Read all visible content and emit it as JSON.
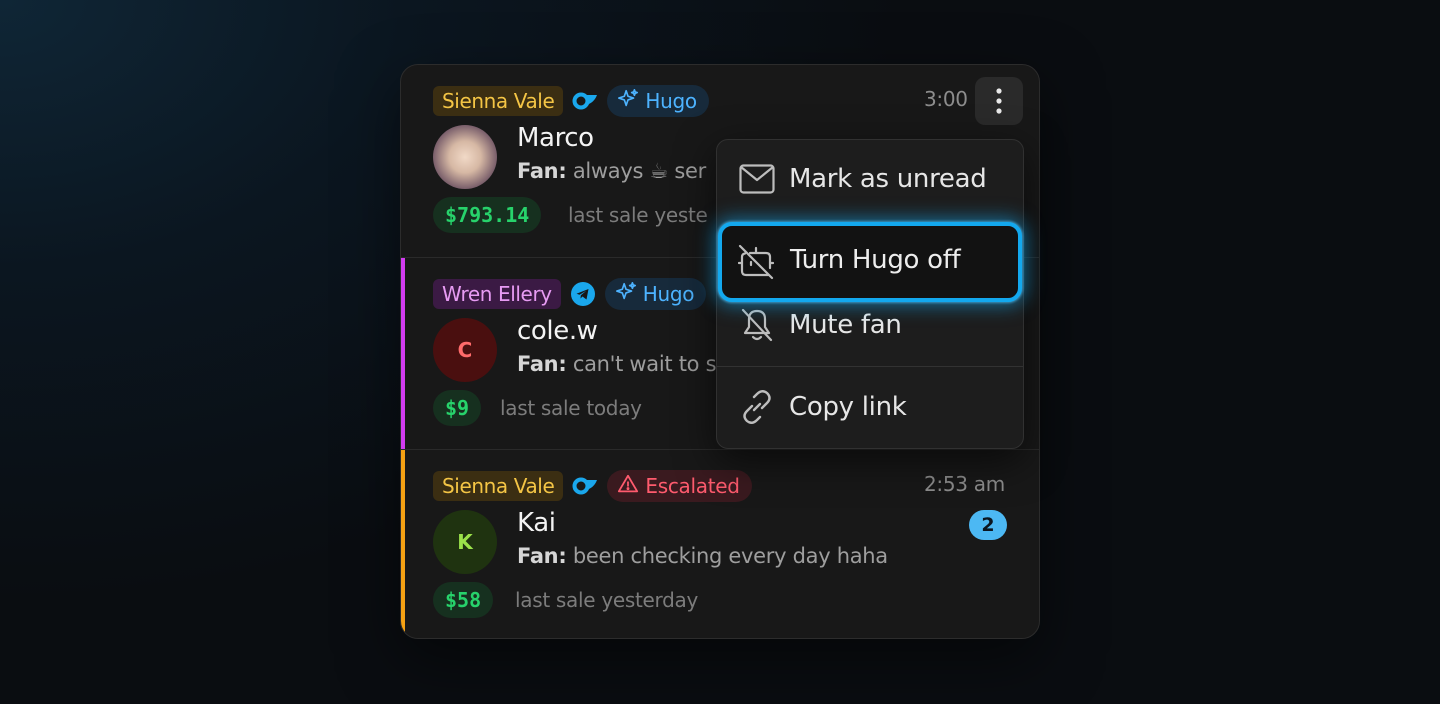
{
  "colors": {
    "accent_gold": "#f4c545",
    "accent_violet": "#d33cf0",
    "accent_orange": "#f5a113",
    "hugo_blue": "#4db3ff",
    "escalated_red": "#ff5b6e",
    "money_green": "#27d26b",
    "focus_ring": "#13a8ee"
  },
  "conversations": [
    {
      "creator": "Sienna Vale",
      "platform_icon": "onlyfans-icon",
      "status_pill": "Hugo",
      "time": "3:00",
      "name": "Marco",
      "preview_prefix": "Fan:",
      "preview_text": "always ☕ ser",
      "amount": "$793.14",
      "last_sale": "last sale yeste"
    },
    {
      "creator": "Wren Ellery",
      "platform_icon": "telegram-icon",
      "status_pill": "Hugo",
      "avatar_initial": "C",
      "name": "cole.w",
      "preview_prefix": "Fan:",
      "preview_text": "can't wait to s",
      "amount": "$9",
      "last_sale": "last sale today"
    },
    {
      "creator": "Sienna Vale",
      "platform_icon": "onlyfans-icon",
      "status_pill": "Escalated",
      "time": "2:53 am",
      "avatar_initial": "K",
      "name": "Kai",
      "unread": "2",
      "preview_prefix": "Fan:",
      "preview_text": "been checking every day haha",
      "amount": "$58",
      "last_sale": "last sale yesterday"
    }
  ],
  "menu": {
    "items": [
      {
        "label": "Mark as unread",
        "icon": "envelope-icon"
      },
      {
        "label": "Turn Hugo off",
        "icon": "bot-off-icon"
      },
      {
        "label": "Mute fan",
        "icon": "bell-off-icon"
      },
      {
        "label": "Copy link",
        "icon": "link-icon"
      }
    ]
  }
}
